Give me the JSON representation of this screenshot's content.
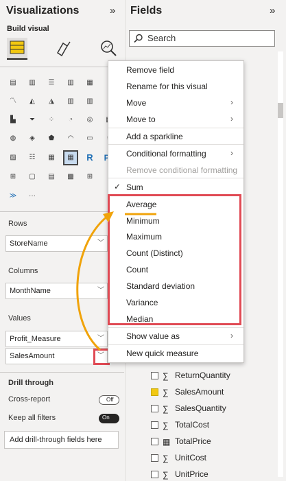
{
  "visualizations": {
    "title": "Visualizations",
    "collapse_icon": "»",
    "build_label": "Build visual",
    "more_label": "···",
    "rows_label": "Rows",
    "rows_value": "StoreName",
    "columns_label": "Columns",
    "columns_value": "MonthName",
    "values_label": "Values",
    "values_items": [
      "Profit_Measure",
      "SalesAmount"
    ],
    "drill_label": "Drill through",
    "cross_report_label": "Cross-report",
    "cross_report_toggle": "Off",
    "keep_filters_label": "Keep all filters",
    "keep_filters_toggle": "On",
    "add_drill_label": "Add drill-through fields here"
  },
  "fields": {
    "title": "Fields",
    "collapse_icon": "»",
    "search_placeholder": "Search",
    "list": [
      {
        "label": "ReturnQuantity",
        "checked": false,
        "icon": "sigma"
      },
      {
        "label": "SalesAmount",
        "checked": true,
        "icon": "sigma"
      },
      {
        "label": "SalesQuantity",
        "checked": false,
        "icon": "sigma"
      },
      {
        "label": "TotalCost",
        "checked": false,
        "icon": "sigma"
      },
      {
        "label": "TotalPrice",
        "checked": false,
        "icon": "calculator"
      },
      {
        "label": "UnitCost",
        "checked": false,
        "icon": "sigma"
      },
      {
        "label": "UnitPrice",
        "checked": false,
        "icon": "sigma"
      }
    ]
  },
  "context_menu": {
    "remove_field": "Remove field",
    "rename": "Rename for this visual",
    "move": "Move",
    "move_to": "Move to",
    "add_sparkline": "Add a sparkline",
    "conditional_formatting": "Conditional formatting",
    "remove_conditional": "Remove conditional formatting",
    "sum": "Sum",
    "average": "Average",
    "minimum": "Minimum",
    "maximum": "Maximum",
    "count_distinct": "Count (Distinct)",
    "count": "Count",
    "std_dev": "Standard deviation",
    "variance": "Variance",
    "median": "Median",
    "show_value_as": "Show value as",
    "new_quick_measure": "New quick measure"
  },
  "colors": {
    "highlight_red": "#e04a54",
    "arrow_orange": "#f0a30a",
    "check_yellow": "#f2c811"
  }
}
